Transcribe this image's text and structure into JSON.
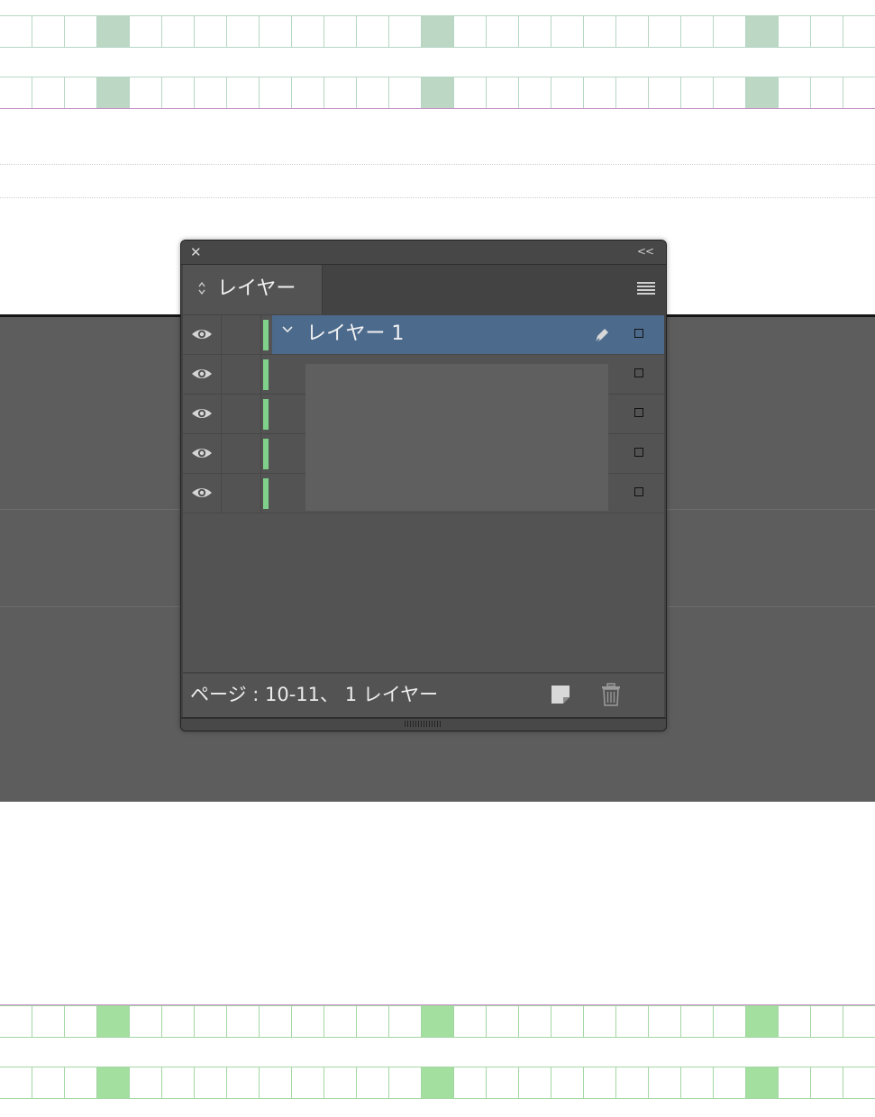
{
  "panel": {
    "close_glyph": "✕",
    "collapse_glyph": "<<",
    "tab": {
      "label": "レイヤー",
      "arrows_glyph": "⌃⌄"
    },
    "layers": [
      {
        "name": "レイヤー 1",
        "expanded": true,
        "selected": true,
        "color": "#7fd08a"
      }
    ],
    "status": "ページ : 10-11、 1 レイヤー"
  },
  "icons": [
    "close-icon",
    "collapse-icon",
    "panel-menu-icon",
    "eye-icon",
    "pen-icon",
    "target-icon",
    "new-layer-icon",
    "trash-icon",
    "chevron-down-icon"
  ],
  "colors": {
    "selection": "#4c6a8c",
    "layer_color": "#7fd08a",
    "grid_top_fill": "#bcd7c4",
    "grid_bottom_fill": "#a3df9f"
  }
}
